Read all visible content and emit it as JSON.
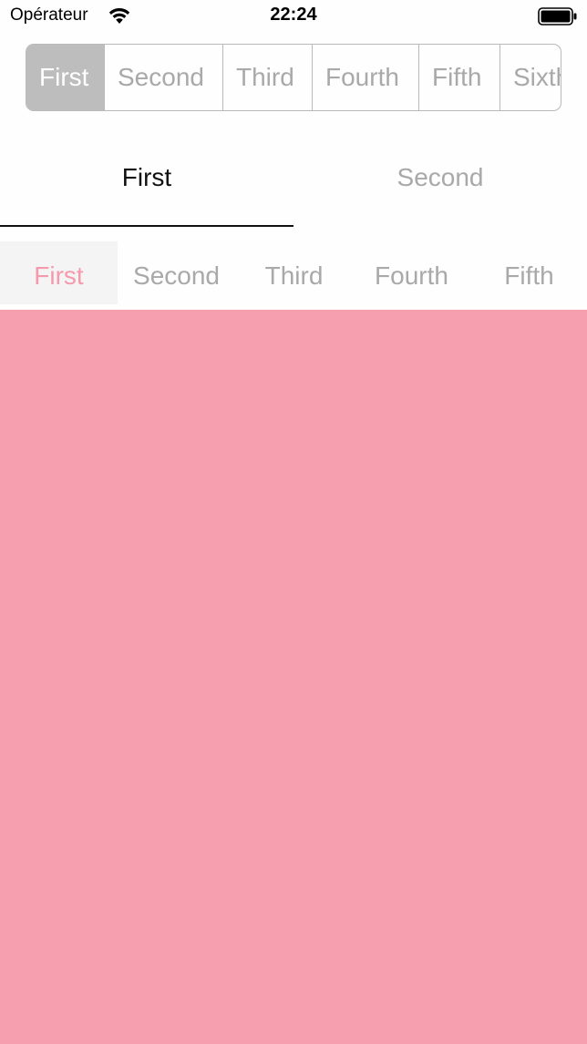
{
  "status_bar": {
    "carrier": "Opérateur",
    "time": "22:24",
    "wifi_icon": "wifi-icon",
    "battery_icon": "battery-full-icon"
  },
  "segmented_control": {
    "segments": [
      "First",
      "Second",
      "Third",
      "Fourth",
      "Fifth",
      "Sixth"
    ],
    "selected_index": 0
  },
  "underline_tabs": {
    "tabs": [
      "First",
      "Second"
    ],
    "selected_index": 0
  },
  "strip_tabs": {
    "tabs": [
      "First",
      "Second",
      "Third",
      "Fourth",
      "Fifth"
    ],
    "selected_index": 0
  },
  "colors": {
    "accent_pink": "#f49aac",
    "page_background": "#f6a0af",
    "inactive_text": "#a9a9a9",
    "segment_selected_bg": "#bdbdbd"
  }
}
